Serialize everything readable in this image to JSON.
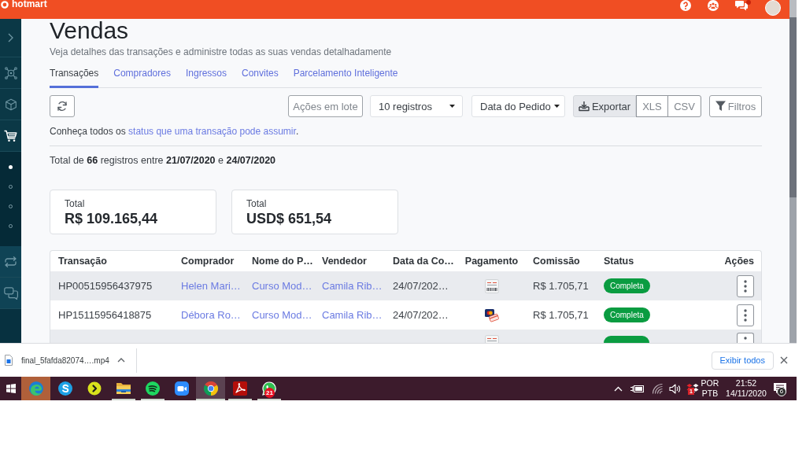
{
  "topbar": {
    "logo": "hotmart",
    "chat_unread": true
  },
  "sidebar": {
    "items": [
      {
        "selected": false
      },
      {
        "selected": false
      },
      {
        "selected": true,
        "children": [
          {
            "selected": true
          },
          {
            "selected": false
          },
          {
            "selected": false
          },
          {
            "selected": false
          }
        ]
      },
      {
        "selected": false
      },
      {
        "selected": false
      }
    ]
  },
  "page": {
    "title": "Vendas",
    "subtitle": "Veja detalhes das transações e administre todas as suas vendas detalhadamente"
  },
  "tabs": [
    {
      "label": "Transações",
      "selected": true
    },
    {
      "label": "Compradores",
      "selected": false
    },
    {
      "label": "Ingressos",
      "selected": false
    },
    {
      "label": "Convites",
      "selected": false
    },
    {
      "label": "Parcelamento Inteligente",
      "selected": false
    }
  ],
  "toolbar": {
    "batch_actions": "Ações em lote",
    "page_size": "10 registros",
    "date_field": "Data do Pedido",
    "export": "Exportar",
    "export_formats": [
      "XLS",
      "CSV"
    ],
    "filters": "Filtros"
  },
  "status_note": {
    "text_before": "Conheça todos os ",
    "link": "status que uma transação pode assumir",
    "text_after": "."
  },
  "summary": "Total de **66** registros entre **21/07/2020** e **24/07/2020**",
  "totals": [
    {
      "label": "Total",
      "value": "R$ 109.165,44"
    },
    {
      "label": "Total",
      "value": "USD$ 651,54"
    }
  ],
  "table": {
    "columns": [
      "Transação",
      "Comprador",
      "Nome do P…",
      "Vendedor",
      "Data da Co…",
      "Pagamento",
      "Comissão",
      "Status",
      "Ações"
    ],
    "rows": [
      {
        "kind": "full",
        "transaction": "HP00515956437975",
        "buyer": "Helen Mari…",
        "product": "Curso Mod…",
        "seller": "Camila Rib…",
        "date": "24/07/202…",
        "payment": {
          "kind": "boleto"
        },
        "commission": "R$ 1.705,71",
        "status": "Completa"
      },
      {
        "kind": "full",
        "transaction": "HP15115956418875",
        "buyer": "Débora Ro…",
        "product": "Curso Mod…",
        "seller": "Camila Rib…",
        "date": "24/07/202…",
        "payment": {
          "kind": "card"
        },
        "commission": "R$ 1.705,71",
        "status": "Completa"
      },
      {
        "kind": "partial",
        "payment": {
          "kind": "boleto"
        }
      }
    ]
  },
  "download_bar": {
    "file_name": "final_5fafda82074….mp4",
    "show_all": "Exibir todos"
  },
  "taskbar": {
    "apps": [
      {
        "flashing": true,
        "active": false,
        "running": false
      },
      {
        "flashing": false,
        "active": false,
        "running": false
      },
      {
        "flashing": false,
        "active": false,
        "running": false
      },
      {
        "flashing": false,
        "active": false,
        "running": true
      },
      {
        "flashing": false,
        "active": false,
        "running": true
      },
      {
        "flashing": false,
        "active": false,
        "running": false
      },
      {
        "flashing": false,
        "active": true,
        "running": true
      },
      {
        "flashing": false,
        "active": false,
        "running": true
      },
      {
        "flashing": false,
        "active": false,
        "running": true,
        "badge": "21"
      }
    ],
    "tray": {
      "badge": "1",
      "language": [
        "POR",
        "PTB"
      ],
      "time": "21:52",
      "date": "14/11/2020",
      "notifications": "6"
    }
  }
}
